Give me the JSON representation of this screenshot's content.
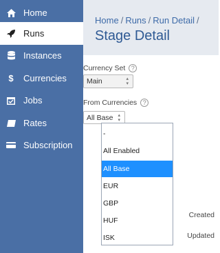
{
  "sidebar": {
    "items": [
      {
        "label": "Home",
        "icon": "home-icon"
      },
      {
        "label": "Runs",
        "icon": "rocket-icon"
      },
      {
        "label": "Instances",
        "icon": "database-icon"
      },
      {
        "label": "Currencies",
        "icon": "dollar-icon"
      },
      {
        "label": "Jobs",
        "icon": "calendar-check-icon"
      },
      {
        "label": "Rates",
        "icon": "tag-icon"
      },
      {
        "label": "Subscription",
        "icon": "card-icon"
      }
    ],
    "active": "Runs"
  },
  "breadcrumb": {
    "items": [
      "Home",
      "Runs",
      "Run Detail"
    ],
    "separator": "/"
  },
  "page": {
    "title": "Stage Detail"
  },
  "form": {
    "currency_set": {
      "label": "Currency Set",
      "help": "?",
      "value": "Main"
    },
    "from_currencies": {
      "label": "From Currencies",
      "help": "?",
      "value": "All Base",
      "options": [
        "-",
        "All Enabled",
        "All Base",
        "EUR",
        "GBP",
        "HUF",
        "ISK"
      ],
      "highlighted": "All Base"
    }
  },
  "meta": {
    "created_label": "Created",
    "updated_label": "Updated"
  },
  "colors": {
    "sidebar": "#4a6fa5",
    "header": "#e6eaf0",
    "accent": "#1e90ff",
    "title": "#2f5a94"
  }
}
